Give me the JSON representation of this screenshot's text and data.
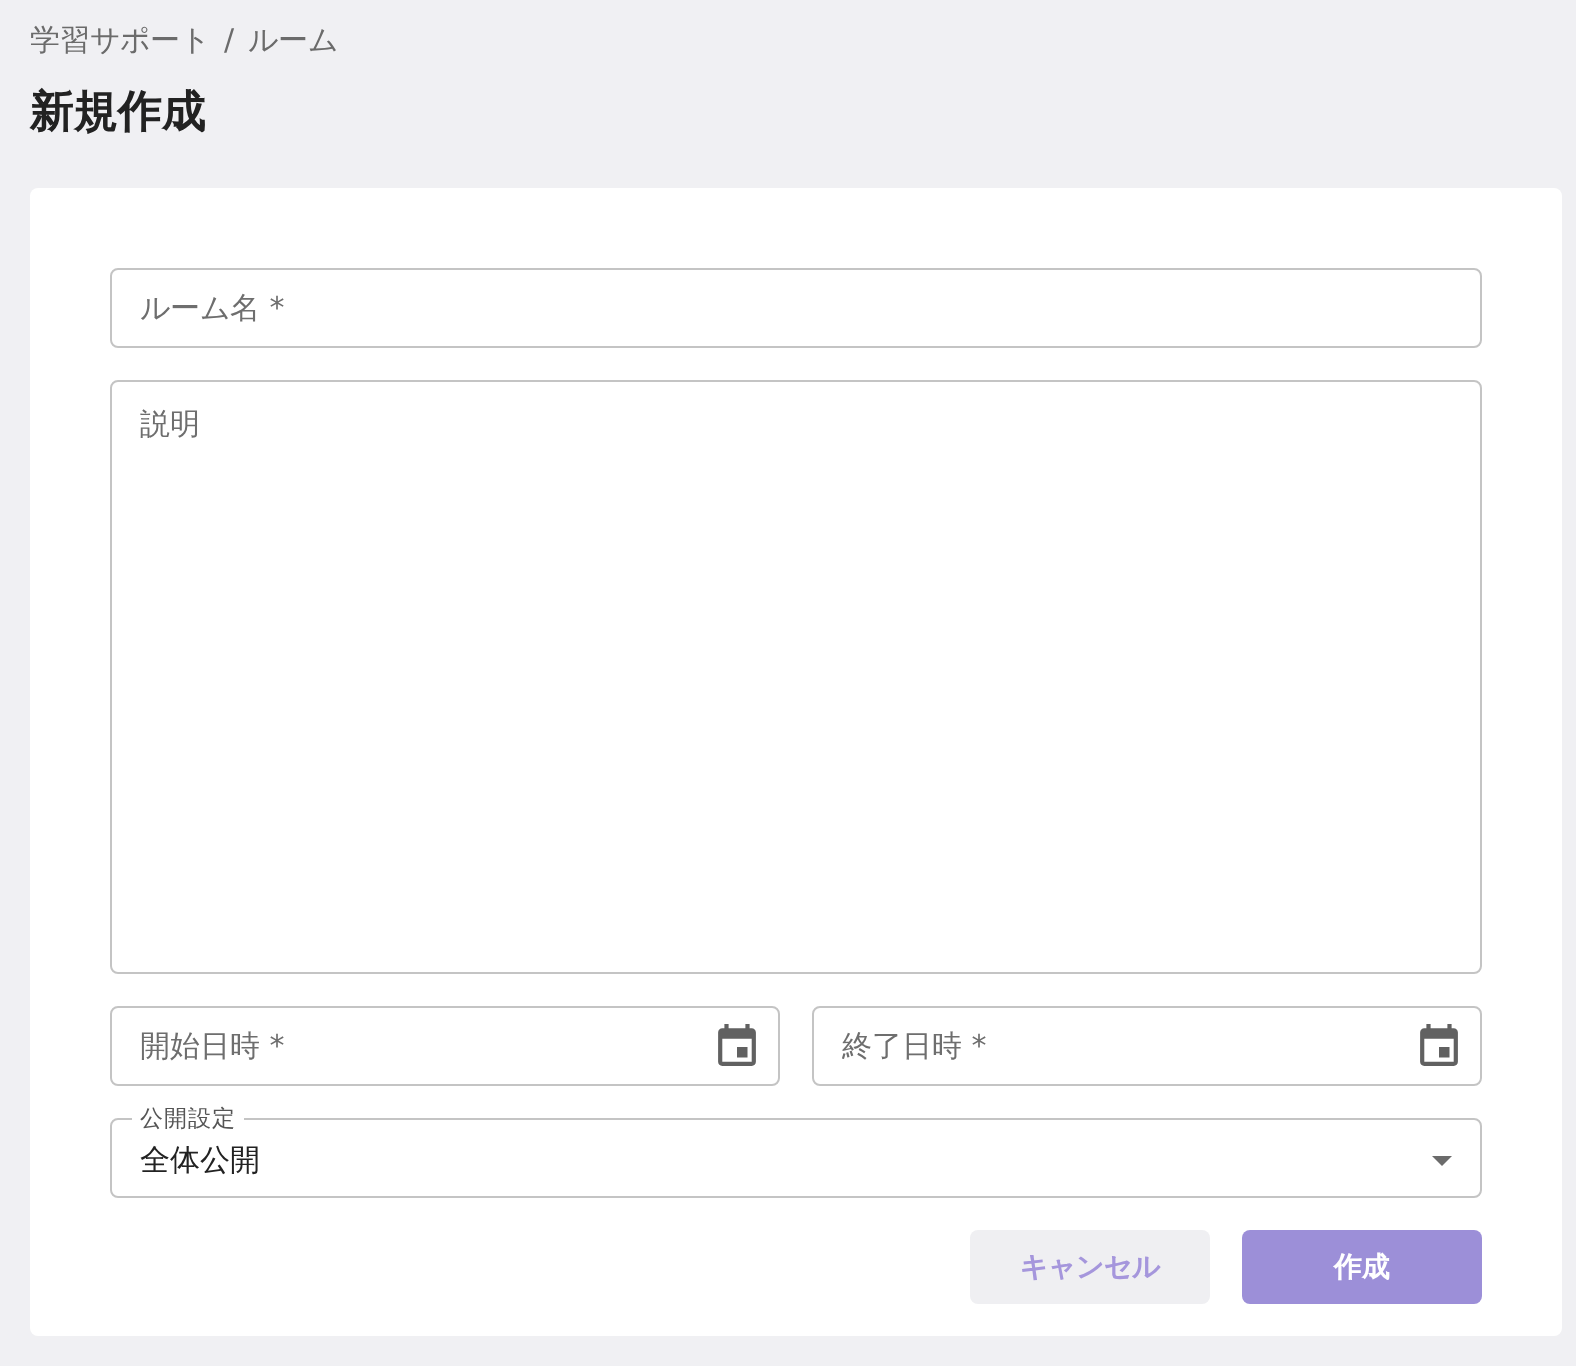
{
  "breadcrumb": {
    "items": [
      "学習サポート",
      "ルーム"
    ],
    "separator": "/"
  },
  "title": "新規作成",
  "form": {
    "fields": [
      {
        "kind": "text",
        "placeholder": "ルーム名 *"
      },
      {
        "kind": "textarea",
        "placeholder": "説明"
      },
      {
        "kind": "datetime",
        "placeholder": "開始日時 *"
      },
      {
        "kind": "datetime",
        "placeholder": "終了日時 *"
      },
      {
        "kind": "select",
        "label": "公開設定",
        "value": "全体公開"
      }
    ],
    "buttons": [
      {
        "kind": "secondary",
        "label": "キャンセル"
      },
      {
        "kind": "primary",
        "label": "作成"
      }
    ]
  }
}
